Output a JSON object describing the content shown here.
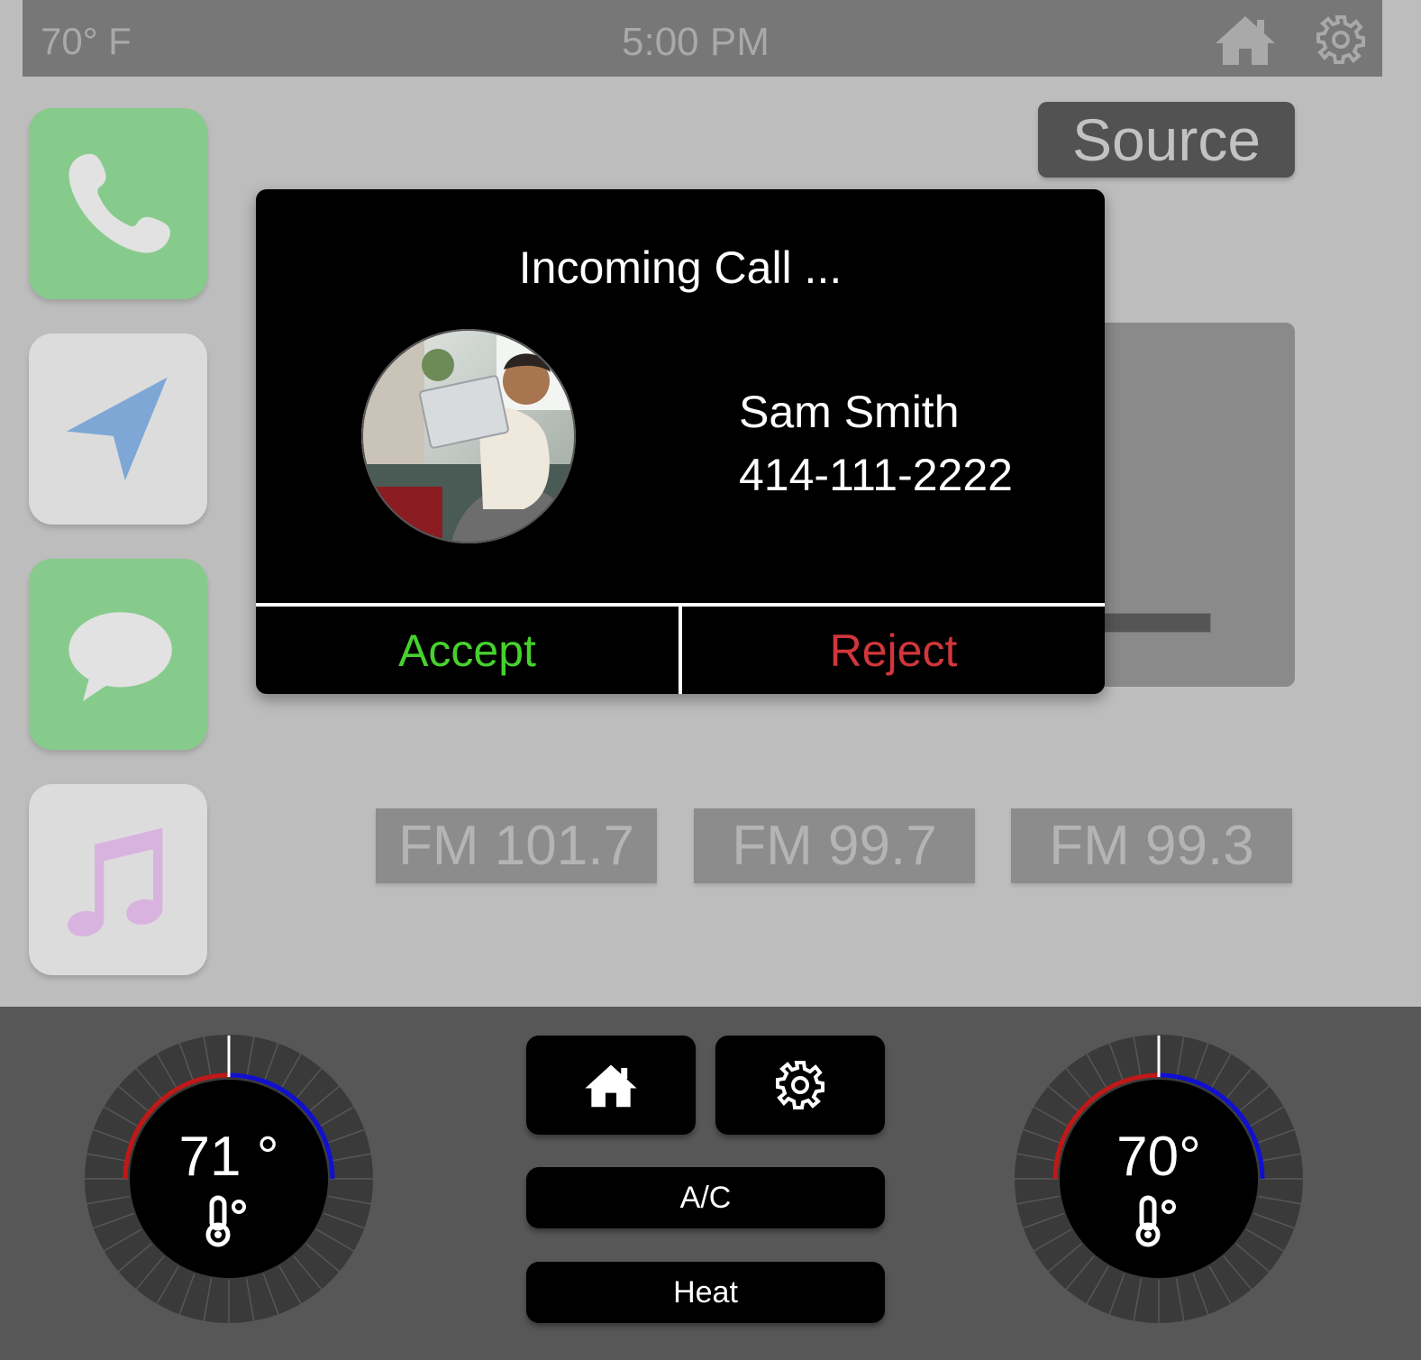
{
  "status_bar": {
    "outside_temp": "70° F",
    "time": "5:00 PM",
    "home_icon": "home-icon",
    "settings_icon": "gear-icon"
  },
  "apps": [
    {
      "name": "Phone",
      "icon": "phone-icon",
      "color": "#86cb8b"
    },
    {
      "name": "Navigation",
      "icon": "navigation-arrow-icon",
      "color": "#dcdcdc"
    },
    {
      "name": "Messages",
      "icon": "message-bubble-icon",
      "color": "#86cb8b"
    },
    {
      "name": "Music",
      "icon": "music-note-icon",
      "color": "#dcdcdc"
    }
  ],
  "source": {
    "label": "Source"
  },
  "media": {
    "progress": 0.85
  },
  "presets": [
    "FM 101.7",
    "FM 99.7",
    "FM 99.3"
  ],
  "call": {
    "title": "Incoming Call ...",
    "caller_name": "Sam Smith",
    "caller_number": "414-111-2222",
    "avatar_icon": "caller-photo",
    "accept_label": "Accept",
    "reject_label": "Reject",
    "accept_color": "#46d12e",
    "reject_color": "#d0363b"
  },
  "climate": {
    "left_temp": "71 °",
    "right_temp": "70°",
    "thermometer_icon": "thermometer-icon",
    "home_icon": "home-icon",
    "settings_icon": "gear-icon",
    "ac_label": "A/C",
    "heat_label": "Heat",
    "cold_color": "#1010d0",
    "hot_color": "#c01818"
  }
}
